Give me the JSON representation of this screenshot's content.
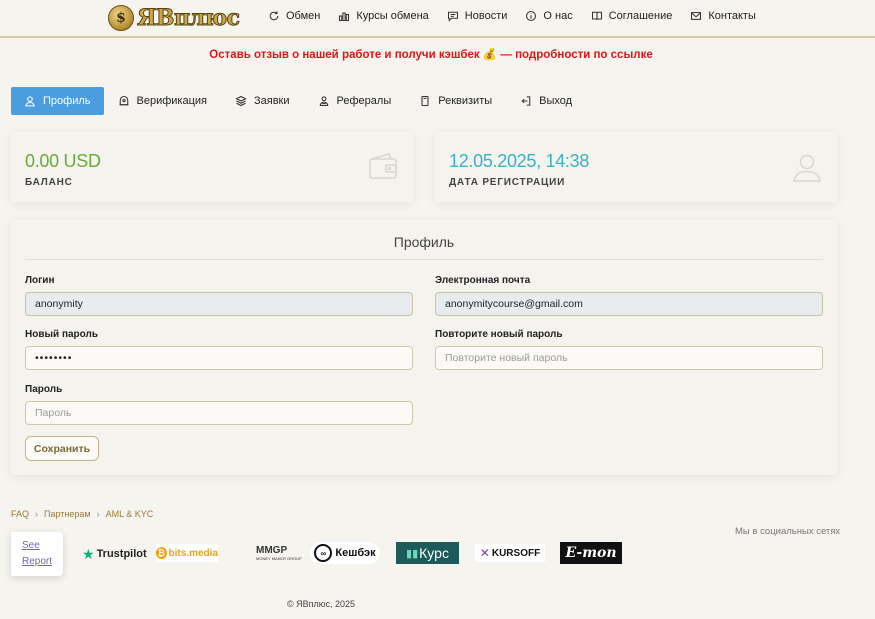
{
  "header": {
    "logo_text": "ЯВплюс",
    "nav": [
      {
        "label": "Обмен",
        "icon": "refresh-icon"
      },
      {
        "label": "Курсы обмена",
        "icon": "bar-chart-icon"
      },
      {
        "label": "Новости",
        "icon": "message-icon"
      },
      {
        "label": "О нас",
        "icon": "info-icon"
      },
      {
        "label": "Соглашение",
        "icon": "book-icon"
      },
      {
        "label": "Контакты",
        "icon": "mail-icon"
      }
    ]
  },
  "banner": {
    "text_before": "Оставь отзыв о нашей работе и получи кэшбек",
    "icon": "money-bag-icon",
    "text_after": "— подробности по ссылке"
  },
  "tabs": [
    {
      "label": "Профиль",
      "icon": "user-icon",
      "active": true
    },
    {
      "label": "Верификация",
      "icon": "verify-icon",
      "active": false
    },
    {
      "label": "Заявки",
      "icon": "layers-icon",
      "active": false
    },
    {
      "label": "Рефералы",
      "icon": "users-icon",
      "active": false
    },
    {
      "label": "Реквизиты",
      "icon": "card-icon",
      "active": false
    },
    {
      "label": "Выход",
      "icon": "logout-icon",
      "active": false
    }
  ],
  "stats": {
    "balance": {
      "value": "0.00 USD",
      "label": "БАЛАНС",
      "color": "#6aaa3a",
      "icon": "wallet-icon"
    },
    "registration": {
      "value": "12.05.2025, 14:38",
      "label": "ДАТА РЕГИСТРАЦИИ",
      "color": "#3ab0c6",
      "icon": "user-silhouette-icon"
    }
  },
  "profile": {
    "title": "Профиль",
    "login": {
      "label": "Логин",
      "value": "anonymity"
    },
    "email": {
      "label": "Электронная почта",
      "value": "anonymitycourse@gmail.com"
    },
    "new_password": {
      "label": "Новый пароль",
      "value": "••••••••"
    },
    "repeat_password": {
      "label": "Повторите новый пароль",
      "placeholder": "Повторите новый пароль"
    },
    "password": {
      "label": "Пароль",
      "placeholder": "Пароль"
    },
    "save_label": "Сохранить"
  },
  "footer": {
    "breadcrumbs": [
      "FAQ",
      "Партнерам",
      "AML & KYC"
    ],
    "social_label": "Мы в социальных сетях",
    "report_line1": "See",
    "report_line2": "Report",
    "partners": [
      "Trustpilot",
      "bits.media",
      "MMGP",
      "Кешбэк",
      "Курс",
      "KURSOFF",
      "E-mon"
    ],
    "mmgp_tagline": "MONEY MAKER GROUP",
    "copyright": "© ЯВплюс, 2025"
  }
}
